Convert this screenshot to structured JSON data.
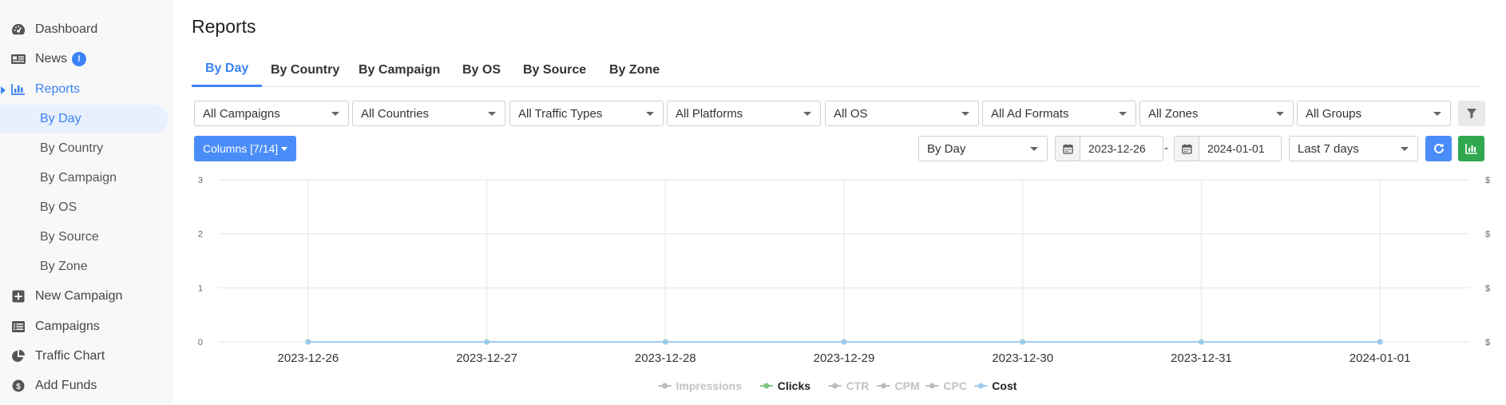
{
  "sidebar": {
    "items": [
      {
        "label": "Dashboard",
        "icon": "dashboard-icon"
      },
      {
        "label": "News",
        "icon": "news-icon",
        "badge": "!"
      },
      {
        "label": "Reports",
        "icon": "reports-icon"
      },
      {
        "label": "New Campaign",
        "icon": "plus-square-icon"
      },
      {
        "label": "Campaigns",
        "icon": "list-icon"
      },
      {
        "label": "Traffic Chart",
        "icon": "pie-chart-icon"
      },
      {
        "label": "Add Funds",
        "icon": "coin-icon"
      }
    ],
    "report_subitems": [
      "By Day",
      "By Country",
      "By Campaign",
      "By OS",
      "By Source",
      "By Zone"
    ]
  },
  "page": {
    "title": "Reports",
    "tabs": [
      "By Day",
      "By Country",
      "By Campaign",
      "By OS",
      "By Source",
      "By Zone"
    ]
  },
  "filters": {
    "campaigns": "All Campaigns",
    "countries": "All Countries",
    "traffic_types": "All Traffic Types",
    "platforms": "All Platforms",
    "os": "All OS",
    "ad_formats": "All Ad Formats",
    "zones": "All Zones",
    "groups": "All Groups"
  },
  "toolbar": {
    "columns_label": "Columns [7/14]",
    "group_by": "By Day",
    "date_from": "2023-12-26",
    "date_separator": "-",
    "date_to": "2024-01-01",
    "range": "Last 7 days"
  },
  "colors": {
    "accent": "#3b82f6",
    "success": "#2fa84f",
    "clicks_series": "#7cc47f",
    "cost_series": "#9fcbed",
    "inactive_legend": "#bdbdbd"
  },
  "chart_data": {
    "type": "line",
    "x": [
      "2023-12-26",
      "2023-12-27",
      "2023-12-28",
      "2023-12-29",
      "2023-12-30",
      "2023-12-31",
      "2024-01-01"
    ],
    "y_ticks": [
      0,
      1,
      2,
      3
    ],
    "ylim": [
      0,
      3
    ],
    "right_axis_ticks": [
      "$",
      "$",
      "$",
      "$"
    ],
    "grid": true,
    "legend_position": "bottom-center",
    "series": [
      {
        "name": "Impressions",
        "active": false,
        "values": [
          0,
          0,
          0,
          0,
          0,
          0,
          0
        ]
      },
      {
        "name": "Clicks",
        "active": true,
        "values": [
          0,
          0,
          0,
          0,
          0,
          0,
          0
        ]
      },
      {
        "name": "CTR",
        "active": false,
        "values": [
          0,
          0,
          0,
          0,
          0,
          0,
          0
        ]
      },
      {
        "name": "CPM",
        "active": false,
        "values": [
          0,
          0,
          0,
          0,
          0,
          0,
          0
        ]
      },
      {
        "name": "CPC",
        "active": false,
        "values": [
          0,
          0,
          0,
          0,
          0,
          0,
          0
        ]
      },
      {
        "name": "Cost",
        "active": true,
        "values": [
          0,
          0,
          0,
          0,
          0,
          0,
          0
        ]
      }
    ]
  }
}
